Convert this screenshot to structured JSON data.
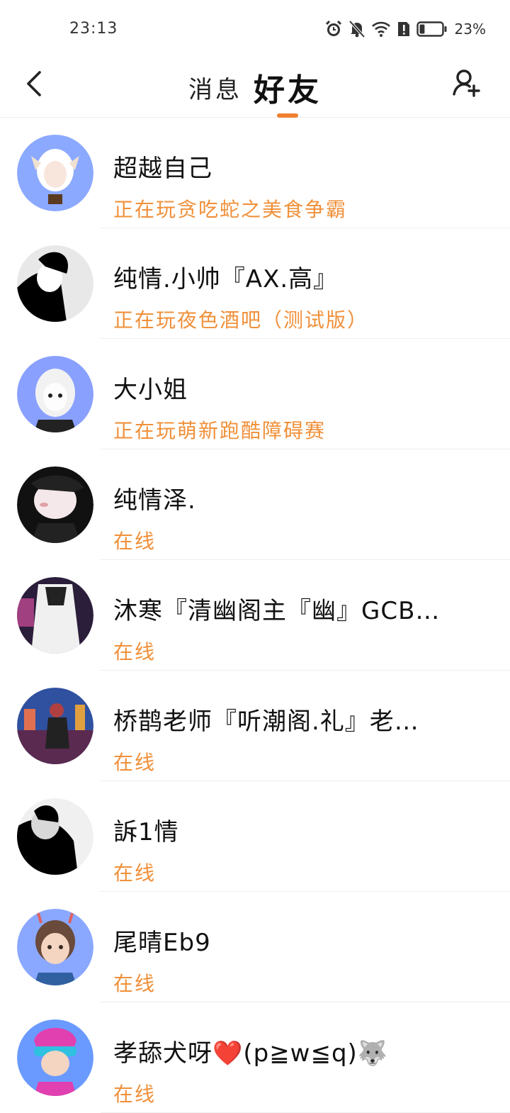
{
  "status_bar": {
    "time": "23:13",
    "battery_percent": "23%",
    "battery_level": 0.23,
    "icons": [
      "alarm-icon",
      "mute-bell-icon",
      "wifi-icon",
      "sim-alert-icon",
      "battery-icon"
    ]
  },
  "header": {
    "tabs": [
      {
        "label": "消息",
        "active": false
      },
      {
        "label": "好友",
        "active": true
      }
    ],
    "accent_color": "#f08030"
  },
  "friends": [
    {
      "name": "超越自己",
      "status": "正在玩贪吃蛇之美食争霸",
      "avatar_colors": [
        "#8ba9ff",
        "#ffffff",
        "#5a3a20"
      ]
    },
    {
      "name": "纯情.小帅『AX.高』",
      "status": "正在玩夜色酒吧（测试版）",
      "avatar_colors": [
        "#e8e8e8",
        "#000000",
        "#ffffff"
      ]
    },
    {
      "name": "大小姐",
      "status": "正在玩萌新跑酷障碍赛",
      "avatar_colors": [
        "#8aa0ff",
        "#f2f2f2",
        "#222222"
      ]
    },
    {
      "name": "纯情泽.",
      "status": "在线",
      "avatar_colors": [
        "#111111",
        "#f5e8ea",
        "#222222"
      ]
    },
    {
      "name": "沐寒『清幽阁主『幽』GCB…",
      "status": "在线",
      "avatar_colors": [
        "#2a1e3a",
        "#f0f0f0",
        "#a04080"
      ]
    },
    {
      "name": "桥鹊老师『听潮阁.礼』老…",
      "status": "在线",
      "avatar_colors": [
        "#3050a0",
        "#b04040",
        "#222222"
      ]
    },
    {
      "name": "訴1情",
      "status": "在线",
      "avatar_colors": [
        "#f0f0f0",
        "#000000",
        "#d8d8d8"
      ]
    },
    {
      "name": "尾晴Eb9",
      "status": "在线",
      "avatar_colors": [
        "#8aa8ff",
        "#6a4a3a",
        "#f3d5c2"
      ]
    },
    {
      "name": "孝舔犬呀❤️(p≧w≦q)🐺",
      "status": "在线",
      "avatar_colors": [
        "#6a9aff",
        "#e040b0",
        "#30c0e0"
      ]
    }
  ]
}
